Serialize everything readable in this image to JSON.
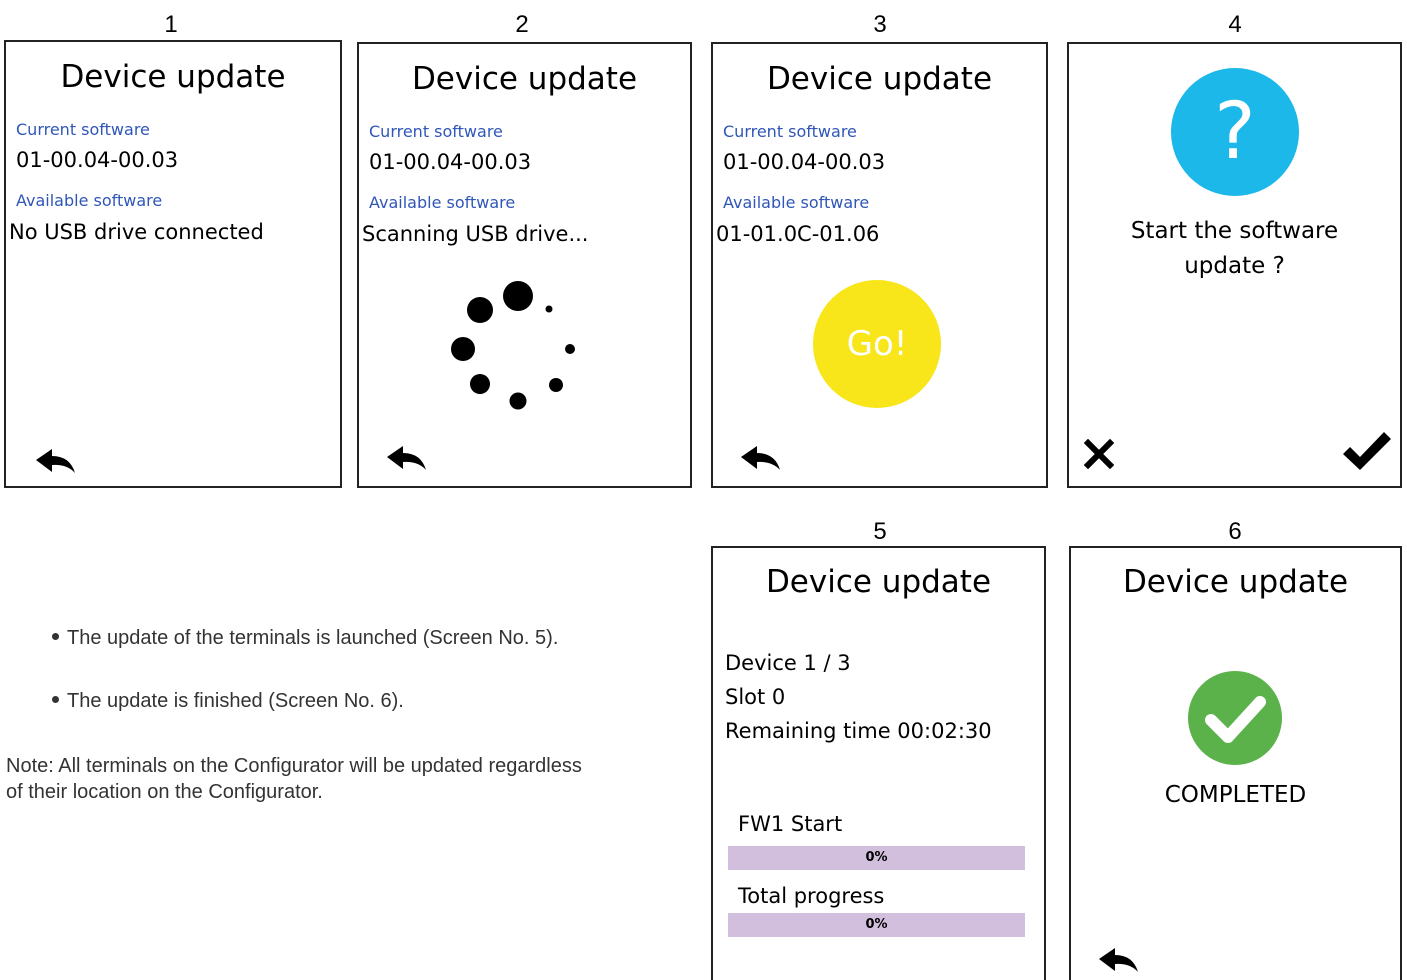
{
  "screen_numbers": [
    "1",
    "2",
    "3",
    "4",
    "5",
    "6"
  ],
  "screen1": {
    "title": "Device update",
    "current_label": "Current software",
    "current_value": "01-00.04-00.03",
    "available_label": "Available software",
    "available_value": "No USB drive connected",
    "back_icon": "back-arrow-icon"
  },
  "screen2": {
    "title": "Device update",
    "current_label": "Current software",
    "current_value": "01-00.04-00.03",
    "available_label": "Available software",
    "available_value": "Scanning USB drive...",
    "spinner_icon": "loading-spinner-icon",
    "back_icon": "back-arrow-icon"
  },
  "screen3": {
    "title": "Device update",
    "current_label": "Current software",
    "current_value": "01-00.04-00.03",
    "available_label": "Available software",
    "available_value": "01-01.0C-01.06",
    "go_label": "Go!",
    "go_color": "#f8e61a",
    "back_icon": "back-arrow-icon"
  },
  "screen4": {
    "question_icon": "question-mark-icon",
    "question_mark": "?",
    "question_color": "#1cb8ea",
    "prompt_line1": "Start the software",
    "prompt_line2": "update ?",
    "cancel_icon": "x-cancel-icon",
    "confirm_icon": "checkmark-confirm-icon"
  },
  "screen5": {
    "title": "Device update",
    "device": "Device 1 / 3",
    "slot": "Slot 0",
    "remaining": "Remaining time 00:02:30",
    "fw_label": "FW1 Start",
    "fw_progress_text": "0%",
    "fw_progress": 0,
    "total_label": "Total progress",
    "total_progress_text": "0%",
    "total_progress": 0,
    "bar_color": "#d2bfdd"
  },
  "screen6": {
    "title": "Device update",
    "status": "COMPLETED",
    "check_color": "#5cb24a",
    "check_icon": "completed-check-icon",
    "back_icon": "back-arrow-icon"
  },
  "text": {
    "bullet1": "The update of the terminals is launched (Screen No. 5).",
    "bullet2": "The update is finished (Screen No. 6).",
    "note_line1": "Note: All terminals on the Configurator will be updated regardless",
    "note_line2": "of their location on the Configurator."
  }
}
